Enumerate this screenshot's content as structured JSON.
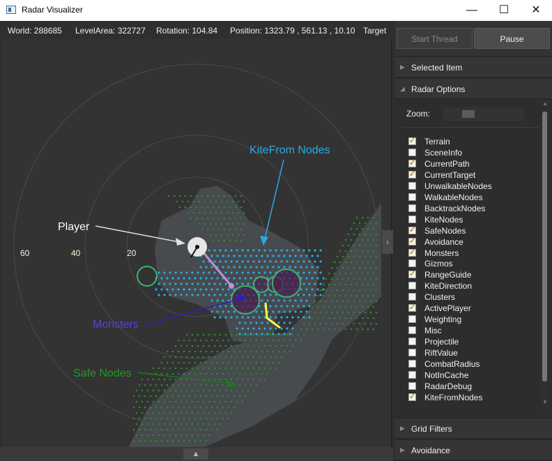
{
  "window": {
    "title": "Radar Visualizer",
    "minimize": "—",
    "maximize": "☐",
    "close": "✕"
  },
  "info": {
    "world": "World: 288685",
    "level_area": "LevelArea: 322727",
    "rotation": "Rotation: 104.84",
    "position": "Position: 1323.79 , 561.13 , 10.10",
    "target": "Target"
  },
  "radar": {
    "ring_labels": [
      "60",
      "40",
      "20"
    ],
    "annotations": {
      "player": "Player",
      "kitefrom": "KiteFrom Nodes",
      "monsters": "Monsters",
      "safe": "Safe Nodes"
    },
    "colors": {
      "background": "#333333",
      "terrain": "#474a4e",
      "kite_nodes": "#29abe2",
      "safe_nodes": "#2e8b2e",
      "monster_ring": "#3cb371",
      "monster_fill": "#4b1f4f",
      "player": "#e6e6e6",
      "current_path": "#c58fdb",
      "yellow_path": "#ffff33",
      "kitefrom_label": "#29abe2",
      "monsters_label": "#5b3fdc",
      "safe_label": "#1f9d1f"
    }
  },
  "panel": {
    "start_thread": "Start Thread",
    "pause": "Pause",
    "selected_item": "Selected Item",
    "radar_options": "Radar Options",
    "zoom_label": "Zoom:",
    "grid_filters": "Grid Filters",
    "avoidance": "Avoidance",
    "options": [
      {
        "label": "Terrain",
        "checked": true
      },
      {
        "label": "SceneInfo",
        "checked": false
      },
      {
        "label": "CurrentPath",
        "checked": true
      },
      {
        "label": "CurrentTarget",
        "checked": true
      },
      {
        "label": "UnwalkableNodes",
        "checked": false
      },
      {
        "label": "WalkableNodes",
        "checked": false
      },
      {
        "label": "BacktrackNodes",
        "checked": false
      },
      {
        "label": "KiteNodes",
        "checked": false
      },
      {
        "label": "SafeNodes",
        "checked": true
      },
      {
        "label": "Avoidance",
        "checked": true
      },
      {
        "label": "Monsters",
        "checked": true
      },
      {
        "label": "Gizmos",
        "checked": false
      },
      {
        "label": "RangeGuide",
        "checked": true
      },
      {
        "label": "KiteDirection",
        "checked": false
      },
      {
        "label": "Clusters",
        "checked": false
      },
      {
        "label": "ActivePlayer",
        "checked": true
      },
      {
        "label": "Weighting",
        "checked": false
      },
      {
        "label": "Misc",
        "checked": false
      },
      {
        "label": "Projectile",
        "checked": false
      },
      {
        "label": "RiftValue",
        "checked": false
      },
      {
        "label": "CombatRadius",
        "checked": false
      },
      {
        "label": "NotInCache",
        "checked": false
      },
      {
        "label": "RadarDebug",
        "checked": false
      },
      {
        "label": "KiteFromNodes",
        "checked": true
      }
    ]
  }
}
